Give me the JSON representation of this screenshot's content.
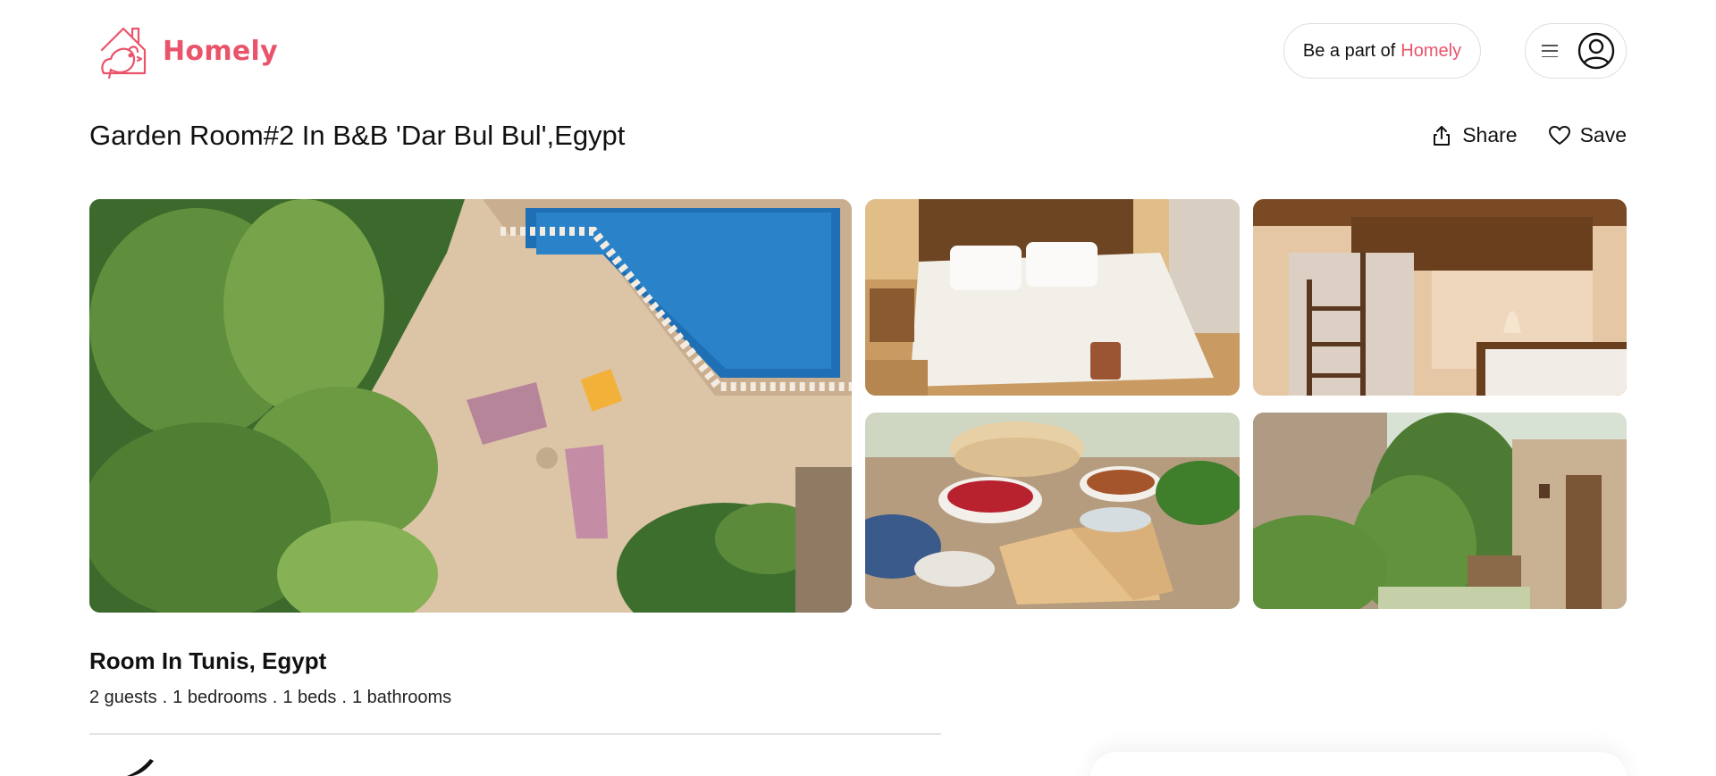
{
  "brand": {
    "name": "Homely",
    "color": "#e9546b",
    "icon": "house-bird-logo-icon"
  },
  "header": {
    "become_prefix": "Be a part of",
    "become_brand": "Homely",
    "menu_icon": "hamburger-menu-icon",
    "avatar_icon": "user-circle-icon"
  },
  "listing": {
    "title": "Garden Room#2 In B&B 'Dar Bul Bul',Egypt",
    "actions": [
      {
        "label": "Share",
        "icon": "share-icon"
      },
      {
        "label": "Save",
        "icon": "heart-icon"
      }
    ],
    "photos": [
      {
        "name": "aerial-pool-patio",
        "description": ""
      },
      {
        "name": "bedroom-bed"
      },
      {
        "name": "loft-bedroom"
      },
      {
        "name": "breakfast-table"
      },
      {
        "name": "garden-courtyard"
      }
    ],
    "room_type": "Room In Tunis, Egypt",
    "specs": [
      "2 guests",
      ".",
      "1 bedrooms",
      ".",
      "1 beds",
      ".",
      "1 bathrooms"
    ]
  }
}
